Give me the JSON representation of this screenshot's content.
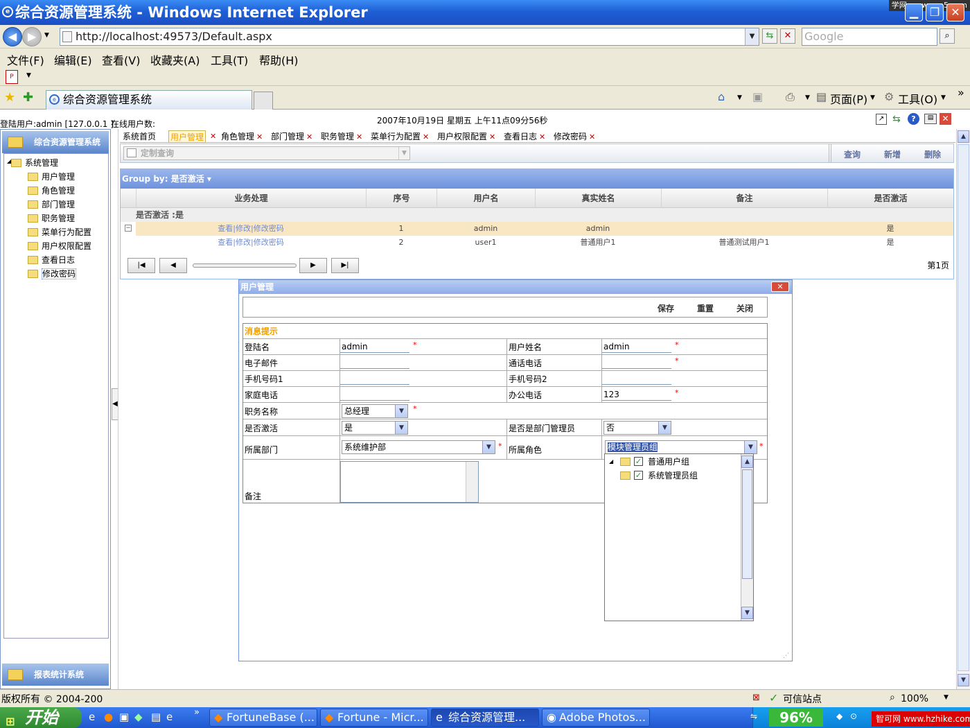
{
  "window": {
    "title": "综合资源管理系统 - Windows Internet Explorer",
    "watermark": "学网 www.xue5.com"
  },
  "browser": {
    "address": "http://localhost:49573/Default.aspx",
    "search_placeholder": "Google",
    "menu": [
      "文件(F)",
      "编辑(E)",
      "查看(V)",
      "收藏夹(A)",
      "工具(T)",
      "帮助(H)"
    ],
    "tab_title": "综合资源管理系统",
    "page_menu": "页面(P)",
    "tools_menu": "工具(O)"
  },
  "app_header": {
    "login_user": "登陆用户:admin [127.0.0.1 ]",
    "online_users": "在线用户数:",
    "datetime": "2007年10月19日  星期五  上午11点09分56秒"
  },
  "left": {
    "top_title": "综合资源管理系统",
    "bottom_title": "报表统计系统",
    "root": "系统管理",
    "items": [
      "用户管理",
      "角色管理",
      "部门管理",
      "职务管理",
      "菜单行为配置",
      "用户权限配置",
      "查看日志",
      "修改密码"
    ]
  },
  "app_tabs": [
    "系统首页",
    "用户管理",
    "角色管理",
    "部门管理",
    "职务管理",
    "菜单行为配置",
    "用户权限配置",
    "查看日志",
    "修改密码"
  ],
  "toolbar": {
    "custom_query": "定制查询",
    "query": "查询",
    "add": "新增",
    "delete": "删除"
  },
  "grid": {
    "group_by": "Group by: 是否激活",
    "headers": [
      "业务处理",
      "序号",
      "用户名",
      "真实姓名",
      "备注",
      "是否激活"
    ],
    "group_line": "是否激活 :是",
    "rows": [
      {
        "actions": "查看|修改|修改密码",
        "seq": "1",
        "username": "admin",
        "realname": "admin",
        "remark": "",
        "active": "是"
      },
      {
        "actions": "查看|修改|修改密码",
        "seq": "2",
        "username": "user1",
        "realname": "普通用户1",
        "remark": "普通测试用户1",
        "active": "是"
      }
    ],
    "page": "第1页"
  },
  "dialog": {
    "title": "用户管理",
    "save": "保存",
    "reset": "重置",
    "close": "关闭",
    "msg": "消息提示",
    "labels": {
      "login": "登陆名",
      "username": "用户姓名",
      "email": "电子邮件",
      "phone": "通话电话",
      "mobile1": "手机号码1",
      "mobile2": "手机号码2",
      "home": "家庭电话",
      "office": "办公电话",
      "position": "职务名称",
      "active": "是否激活",
      "dept_admin": "是否是部门管理员",
      "dept": "所属部门",
      "role": "所属角色",
      "remark": "备注"
    },
    "values": {
      "login": "admin",
      "username": "admin",
      "office": "123",
      "position": "总经理",
      "active": "是",
      "dept_admin": "否",
      "dept": "系统维护部",
      "role": "模块管理员组"
    },
    "required": "*",
    "role_options": [
      "普通用户组",
      "系统管理员组"
    ]
  },
  "statusbar": {
    "copyright": "版权所有 © 2004-200",
    "zone": "可信站点",
    "zoom": "100%"
  },
  "taskbar": {
    "start": "开始",
    "tasks": [
      "FortuneBase (...",
      "Fortune - Micr...",
      "综合资源管理...",
      "Adobe Photos..."
    ],
    "percent": "96%",
    "logo": "智可网 www.hzhike.com"
  }
}
